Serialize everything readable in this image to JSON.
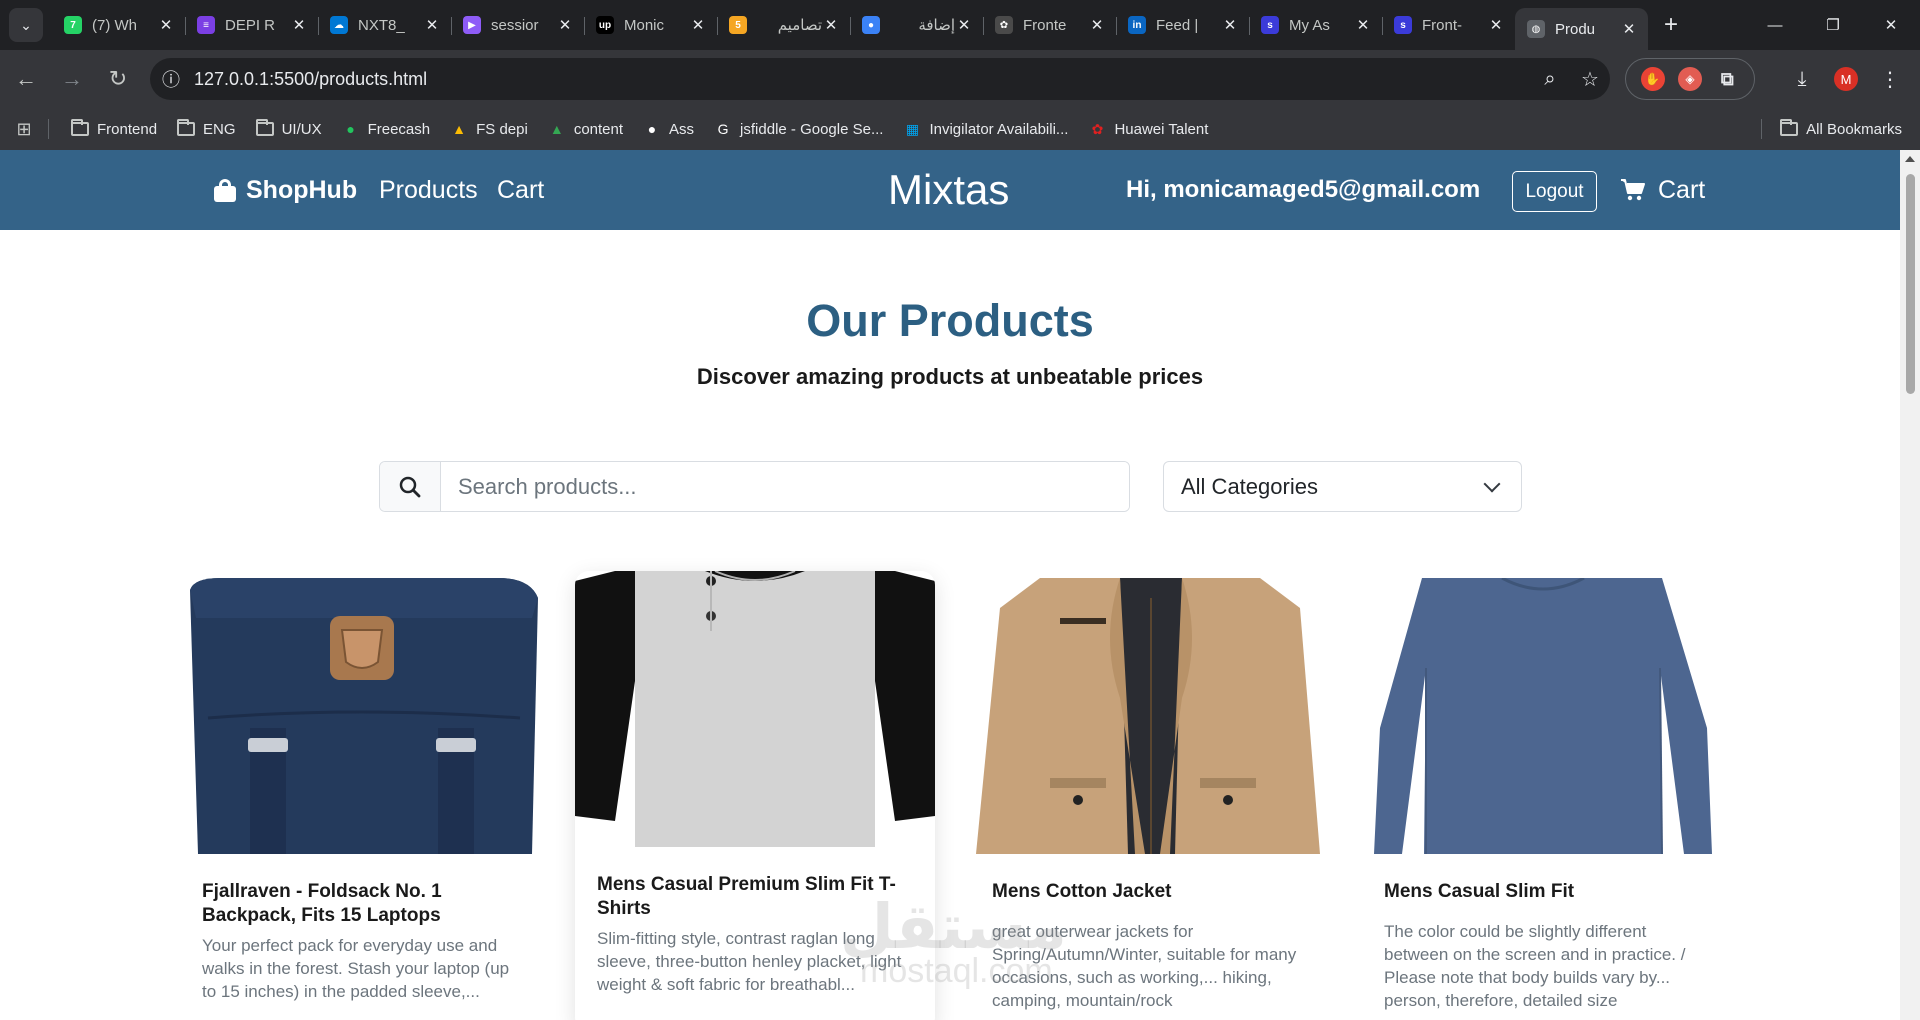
{
  "browser": {
    "tabs": [
      {
        "title": "(7) Wh",
        "favicon": "whatsapp-icon",
        "fav_color": "#25d366",
        "fav_text": "7"
      },
      {
        "title": "DEPI R",
        "favicon": "depi-icon",
        "fav_color": "#7b3fe4",
        "fav_text": "≡"
      },
      {
        "title": "NXT8_",
        "favicon": "onedrive-icon",
        "fav_color": "#0078d4",
        "fav_text": "☁"
      },
      {
        "title": "sessior",
        "favicon": "video-icon",
        "fav_color": "#8e5cf7",
        "fav_text": "▶"
      },
      {
        "title": "Monic",
        "favicon": "upwork-icon",
        "fav_color": "#000000",
        "fav_text": "up"
      },
      {
        "title": "تصاميم",
        "favicon": "five-icon",
        "fav_color": "#f5a623",
        "fav_text": "5"
      },
      {
        "title": "إضافة",
        "favicon": "circle-icon",
        "fav_color": "#3b82f6",
        "fav_text": "●"
      },
      {
        "title": "Fronte",
        "favicon": "openai-icon",
        "fav_color": "#4a4a4a",
        "fav_text": "✿"
      },
      {
        "title": "Feed |",
        "favicon": "linkedin-icon",
        "fav_color": "#0a66c2",
        "fav_text": "in"
      },
      {
        "title": "My As",
        "favicon": "app-icon",
        "fav_color": "#3b3bd9",
        "fav_text": "s"
      },
      {
        "title": "Front-",
        "favicon": "app-icon",
        "fav_color": "#3b3bd9",
        "fav_text": "s"
      },
      {
        "title": "Produ",
        "favicon": "globe-icon",
        "fav_color": "#5f6368",
        "fav_text": "◍",
        "active": true
      }
    ],
    "url": "127.0.0.1:5500/products.html",
    "bookmarks": [
      {
        "label": "Frontend",
        "icon": "folder-icon"
      },
      {
        "label": "ENG",
        "icon": "folder-icon"
      },
      {
        "label": "UI/UX",
        "icon": "folder-icon"
      },
      {
        "label": "Freecash",
        "icon": "freecash-icon",
        "color": "#22c55e",
        "glyph": "●"
      },
      {
        "label": "FS depi",
        "icon": "drive-icon",
        "color": "#fbbc04",
        "glyph": "▲"
      },
      {
        "label": "content",
        "icon": "drive-icon",
        "color": "#34a853",
        "glyph": "▲"
      },
      {
        "label": "Ass",
        "icon": "github-icon",
        "color": "#ffffff",
        "glyph": "●"
      },
      {
        "label": "jsfiddle - Google Se...",
        "icon": "google-icon",
        "color": "#ffffff",
        "glyph": "G"
      },
      {
        "label": "Invigilator Availabili...",
        "icon": "sheet-icon",
        "color": "#00a4ef",
        "glyph": "▦"
      },
      {
        "label": "Huawei Talent",
        "icon": "huawei-icon",
        "color": "#e02020",
        "glyph": "✿"
      }
    ],
    "all_bookmarks": "All Bookmarks",
    "profile_initial": "M"
  },
  "header": {
    "brand": "ShopHub",
    "nav": [
      "Products",
      "Cart"
    ],
    "center": "Mixtas",
    "greeting": "Hi, monicamaged5@gmail.com",
    "logout": "Logout",
    "cart": "Cart",
    "bg_color": "#346388"
  },
  "hero": {
    "title": "Our Products",
    "subtitle": "Discover amazing products at unbeatable prices"
  },
  "filters": {
    "search_placeholder": "Search products...",
    "category_selected": "All Categories"
  },
  "products": [
    {
      "title": "Fjallraven - Foldsack No. 1 Backpack, Fits 15 Laptops",
      "description": "Your perfect pack for everyday use and walks in the forest. Stash your laptop (up to 15 inches) in the padded sleeve,..."
    },
    {
      "title": "Mens Casual Premium Slim Fit T-Shirts",
      "description": "Slim-fitting style, contrast raglan long sleeve, three-button henley placket, light weight & soft fabric for breathabl..."
    },
    {
      "title": "Mens Cotton Jacket",
      "description": "great outerwear jackets for Spring/Autumn/Winter, suitable for many occasions, such as working,... hiking, camping, mountain/rock"
    },
    {
      "title": "Mens Casual Slim Fit",
      "description": "The color could be slightly different between on the screen and in practice. / Please note that body builds vary by... person, therefore, detailed size"
    }
  ],
  "watermark": {
    "text": "مستقل",
    "sub": "mostaql.com"
  }
}
